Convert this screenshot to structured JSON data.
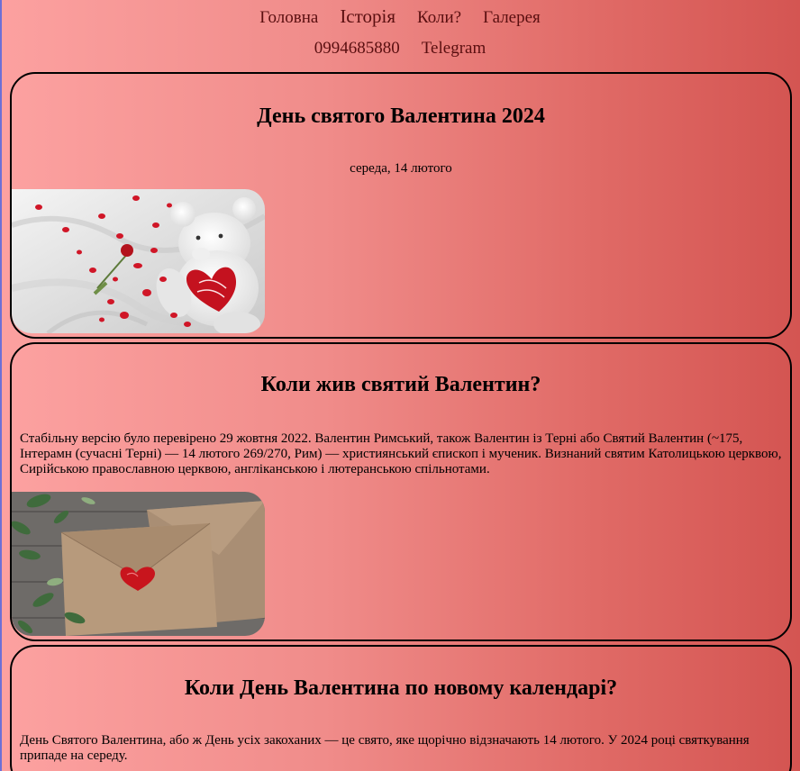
{
  "nav": {
    "row1": [
      "Головна",
      "Історія",
      "Коли?",
      "Галерея"
    ],
    "row2": [
      "0994685880",
      "Telegram"
    ]
  },
  "sections": [
    {
      "title": "День святого Валентина 2024",
      "date": "середа, 14 лютого",
      "image": "teddy-bear-with-heart-and-rose-petals"
    },
    {
      "title": "Коли жив святий Валентин?",
      "text": "Стабільну версію було перевірено 29 жовтня 2022. Валентин Римський, також Валентин із Терні або Святий Валентин (~175, Інтерамн (сучасні Терні) — 14 лютого 269/270, Рим) — християнський єпископ і мученик. Визнаний святим Католицькою церквою, Сирійською православною церквою, англіканською і лютеранською спільнотами.",
      "image": "kraft-envelope-with-red-heart"
    },
    {
      "title": "Коли День Валентина по новому календарі?",
      "text": "День Святого Валентина, або ж День усіх закоханих — це свято, яке щорічно відзначають 14 лютого. У 2024 році святкування припаде на середу."
    }
  ]
}
